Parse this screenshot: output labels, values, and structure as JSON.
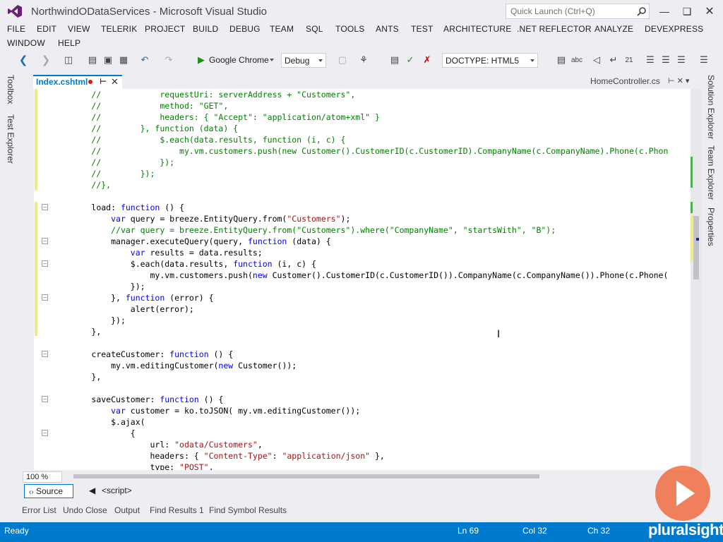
{
  "window": {
    "title": "NorthwindODataServices - Microsoft Visual Studio",
    "quick_launch_placeholder": "Quick Launch (Ctrl+Q)"
  },
  "menu": [
    "FILE",
    "EDIT",
    "VIEW",
    "TELERIK",
    "PROJECT",
    "BUILD",
    "DEBUG",
    "TEAM",
    "SQL",
    "TOOLS",
    "ANTS",
    "TEST",
    "ARCHITECTURE",
    ".NET REFLECTOR",
    "ANALYZE",
    "DEVEXPRESS",
    "WINDOW",
    "HELP"
  ],
  "toolbar": {
    "browser_label": "Google Chrome",
    "config_label": "Debug",
    "doctype_label": "DOCTYPE: HTML5"
  },
  "left_rail": [
    "Toolbox",
    "Test Explorer"
  ],
  "right_rail": [
    "Solution Explorer",
    "Team Explorer",
    "Properties"
  ],
  "tabs": {
    "active": "Index.cshtml",
    "right": "HomeController.cs"
  },
  "code_lines": [
    {
      "indent": "        ",
      "parts": [
        [
          "com",
          "//            requestUri: serverAddress + \"Customers\","
        ]
      ]
    },
    {
      "indent": "        ",
      "parts": [
        [
          "com",
          "//            method: \"GET\","
        ]
      ]
    },
    {
      "indent": "        ",
      "parts": [
        [
          "com",
          "//            headers: { \"Accept\": \"application/atom+xml\" }"
        ]
      ]
    },
    {
      "indent": "        ",
      "parts": [
        [
          "com",
          "//        }, function (data) {"
        ]
      ]
    },
    {
      "indent": "        ",
      "parts": [
        [
          "com",
          "//            $.each(data.results, function (i, c) {"
        ]
      ]
    },
    {
      "indent": "        ",
      "parts": [
        [
          "com",
          "//                my.vm.customers.push(new Customer().CustomerID(c.CustomerID).CompanyName(c.CompanyName).Phone(c.Phon"
        ]
      ]
    },
    {
      "indent": "        ",
      "parts": [
        [
          "com",
          "//            });"
        ]
      ]
    },
    {
      "indent": "        ",
      "parts": [
        [
          "com",
          "//        });"
        ]
      ]
    },
    {
      "indent": "        ",
      "parts": [
        [
          "com",
          "//},"
        ]
      ]
    },
    {
      "indent": "",
      "parts": []
    },
    {
      "indent": "        ",
      "parts": [
        [
          "txt",
          "load: "
        ],
        [
          "kw",
          "function"
        ],
        [
          "txt",
          " () {"
        ]
      ]
    },
    {
      "indent": "            ",
      "parts": [
        [
          "kw",
          "var"
        ],
        [
          "txt",
          " query = breeze.EntityQuery.from("
        ],
        [
          "str",
          "\"Customers\""
        ],
        [
          "txt",
          ");"
        ]
      ]
    },
    {
      "indent": "            ",
      "parts": [
        [
          "com",
          "//var query = breeze.EntityQuery.from(\"Customers\").where(\"CompanyName\", \"startsWith\", \"B\");"
        ]
      ]
    },
    {
      "indent": "            ",
      "parts": [
        [
          "txt",
          "manager.executeQuery(query, "
        ],
        [
          "kw",
          "function"
        ],
        [
          "txt",
          " (data) {"
        ]
      ]
    },
    {
      "indent": "                ",
      "parts": [
        [
          "kw",
          "var"
        ],
        [
          "txt",
          " results = data.results;"
        ]
      ]
    },
    {
      "indent": "                ",
      "parts": [
        [
          "txt",
          "$.each(data.results, "
        ],
        [
          "kw",
          "function"
        ],
        [
          "txt",
          " (i, c) {"
        ]
      ]
    },
    {
      "indent": "                    ",
      "parts": [
        [
          "txt",
          "my.vm.customers.push("
        ],
        [
          "kw",
          "new"
        ],
        [
          "txt",
          " Customer().CustomerID(c.CustomerID()).CompanyName(c.CompanyName()).Phone(c.Phone("
        ]
      ]
    },
    {
      "indent": "                ",
      "parts": [
        [
          "txt",
          "});"
        ]
      ]
    },
    {
      "indent": "            ",
      "parts": [
        [
          "txt",
          "}, "
        ],
        [
          "kw",
          "function"
        ],
        [
          "txt",
          " (error) {"
        ]
      ]
    },
    {
      "indent": "                ",
      "parts": [
        [
          "txt",
          "alert(error);"
        ]
      ]
    },
    {
      "indent": "            ",
      "parts": [
        [
          "txt",
          "});"
        ]
      ]
    },
    {
      "indent": "        ",
      "parts": [
        [
          "txt",
          "},"
        ]
      ]
    },
    {
      "indent": "",
      "parts": []
    },
    {
      "indent": "        ",
      "parts": [
        [
          "txt",
          "createCustomer: "
        ],
        [
          "kw",
          "function"
        ],
        [
          "txt",
          " () {"
        ]
      ]
    },
    {
      "indent": "            ",
      "parts": [
        [
          "txt",
          "my.vm.editingCustomer("
        ],
        [
          "kw",
          "new"
        ],
        [
          "txt",
          " Customer());"
        ]
      ]
    },
    {
      "indent": "        ",
      "parts": [
        [
          "txt",
          "},"
        ]
      ]
    },
    {
      "indent": "",
      "parts": []
    },
    {
      "indent": "        ",
      "parts": [
        [
          "txt",
          "saveCustomer: "
        ],
        [
          "kw",
          "function"
        ],
        [
          "txt",
          " () {"
        ]
      ]
    },
    {
      "indent": "            ",
      "parts": [
        [
          "kw",
          "var"
        ],
        [
          "txt",
          " customer = ko.toJSON( my.vm.editingCustomer());"
        ]
      ]
    },
    {
      "indent": "            ",
      "parts": [
        [
          "txt",
          "$.ajax("
        ]
      ]
    },
    {
      "indent": "                ",
      "parts": [
        [
          "txt",
          "{"
        ]
      ]
    },
    {
      "indent": "                    ",
      "parts": [
        [
          "txt",
          "url: "
        ],
        [
          "str",
          "\"odata/Customers\""
        ],
        [
          "txt",
          ","
        ]
      ]
    },
    {
      "indent": "                    ",
      "parts": [
        [
          "txt",
          "headers: { "
        ],
        [
          "str",
          "\"Content-Type\""
        ],
        [
          "txt",
          ": "
        ],
        [
          "str",
          "\"application/json\""
        ],
        [
          "txt",
          " },"
        ]
      ]
    },
    {
      "indent": "                    ",
      "parts": [
        [
          "txt",
          "type: "
        ],
        [
          "str",
          "\"POST\""
        ],
        [
          "txt",
          ","
        ]
      ]
    }
  ],
  "fold_lines": [
    10,
    13,
    15,
    18,
    23,
    27,
    30
  ],
  "editor_bottom": {
    "zoom": "100 %",
    "source_label": "Source",
    "crumb": "<script>"
  },
  "tool_tabs": [
    "Error List",
    "Undo Close",
    "Output",
    "Find Results 1",
    "Find Symbol Results"
  ],
  "status": {
    "ready": "Ready",
    "line": "Ln 69",
    "col": "Col 32",
    "ch": "Ch 32"
  },
  "watermark": "pluralsight",
  "colors": {
    "accent": "#007acc",
    "comment": "#008000",
    "keyword": "#0000ff",
    "string": "#a31515",
    "pluralsight": "#f05a28"
  }
}
